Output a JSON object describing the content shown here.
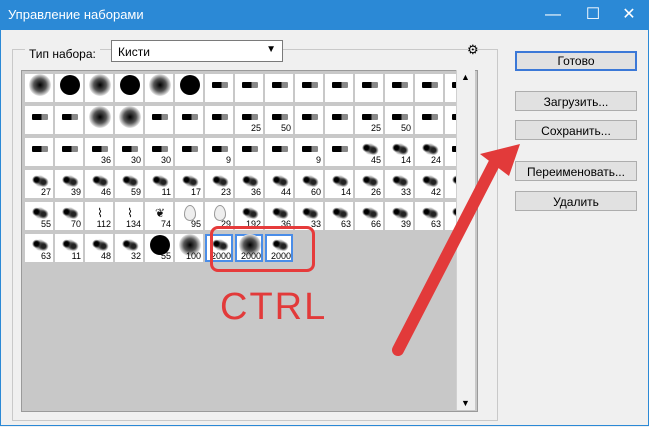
{
  "window": {
    "title": "Управление наборами",
    "min": "—",
    "max": "☐",
    "close": "✕"
  },
  "set_type": {
    "label": "Тип набора:",
    "value": "Кисти"
  },
  "buttons": {
    "done": "Готово",
    "load": "Загрузить...",
    "save": "Сохранить...",
    "rename": "Переименовать...",
    "delete": "Удалить"
  },
  "brushes": [
    {
      "n": "",
      "g": "soft"
    },
    {
      "n": "",
      "g": "hard"
    },
    {
      "n": "",
      "g": "soft"
    },
    {
      "n": "",
      "g": "hard"
    },
    {
      "n": "",
      "g": "soft"
    },
    {
      "n": "",
      "g": "hard"
    },
    {
      "n": "",
      "g": "tool"
    },
    {
      "n": "",
      "g": "tool"
    },
    {
      "n": "",
      "g": "tool"
    },
    {
      "n": "",
      "g": "tool"
    },
    {
      "n": "",
      "g": "tool"
    },
    {
      "n": "",
      "g": "tool"
    },
    {
      "n": "",
      "g": "tool"
    },
    {
      "n": "",
      "g": "tool"
    },
    {
      "n": "",
      "g": "tool"
    },
    {
      "n": "",
      "g": "tool"
    },
    {
      "n": "",
      "g": "tool"
    },
    {
      "n": "",
      "g": "soft"
    },
    {
      "n": "",
      "g": "soft"
    },
    {
      "n": "",
      "g": "tool"
    },
    {
      "n": "",
      "g": "tool"
    },
    {
      "n": "",
      "g": "tool"
    },
    {
      "n": "25",
      "g": "tool"
    },
    {
      "n": "50",
      "g": "tool"
    },
    {
      "n": "",
      "g": "tool"
    },
    {
      "n": "",
      "g": "tool"
    },
    {
      "n": "25",
      "g": "tool"
    },
    {
      "n": "50",
      "g": "tool"
    },
    {
      "n": "",
      "g": "tool"
    },
    {
      "n": "",
      "g": "tool"
    },
    {
      "n": "",
      "g": "tool"
    },
    {
      "n": "",
      "g": "tool"
    },
    {
      "n": "36",
      "g": "tool"
    },
    {
      "n": "30",
      "g": "tool"
    },
    {
      "n": "30",
      "g": "tool"
    },
    {
      "n": "",
      "g": "tool"
    },
    {
      "n": "9",
      "g": "tool"
    },
    {
      "n": "",
      "g": "tool"
    },
    {
      "n": "",
      "g": "tool"
    },
    {
      "n": "9",
      "g": "tool"
    },
    {
      "n": "",
      "g": "tool"
    },
    {
      "n": "45",
      "g": "splat"
    },
    {
      "n": "14",
      "g": "splat"
    },
    {
      "n": "24",
      "g": "splat"
    },
    {
      "n": "",
      "g": "tool"
    },
    {
      "n": "27",
      "g": "splat"
    },
    {
      "n": "39",
      "g": "splat"
    },
    {
      "n": "46",
      "g": "splat"
    },
    {
      "n": "59",
      "g": "splat"
    },
    {
      "n": "11",
      "g": "splat"
    },
    {
      "n": "17",
      "g": "splat"
    },
    {
      "n": "23",
      "g": "splat"
    },
    {
      "n": "36",
      "g": "splat"
    },
    {
      "n": "44",
      "g": "splat"
    },
    {
      "n": "60",
      "g": "splat"
    },
    {
      "n": "14",
      "g": "splat"
    },
    {
      "n": "26",
      "g": "splat"
    },
    {
      "n": "33",
      "g": "splat"
    },
    {
      "n": "42",
      "g": "splat"
    },
    {
      "n": "",
      "g": "splat"
    },
    {
      "n": "55",
      "g": "splat"
    },
    {
      "n": "70",
      "g": "splat"
    },
    {
      "n": "112",
      "g": "grass"
    },
    {
      "n": "134",
      "g": "grass"
    },
    {
      "n": "74",
      "g": "leaf"
    },
    {
      "n": "95",
      "g": "drop"
    },
    {
      "n": "29",
      "g": "drop"
    },
    {
      "n": "192",
      "g": "splat"
    },
    {
      "n": "36",
      "g": "splat"
    },
    {
      "n": "33",
      "g": "splat"
    },
    {
      "n": "63",
      "g": "splat"
    },
    {
      "n": "66",
      "g": "splat"
    },
    {
      "n": "39",
      "g": "splat"
    },
    {
      "n": "63",
      "g": "splat"
    },
    {
      "n": "",
      "g": "splat"
    },
    {
      "n": "63",
      "g": "splat"
    },
    {
      "n": "11",
      "g": "splat"
    },
    {
      "n": "48",
      "g": "splat"
    },
    {
      "n": "32",
      "g": "splat"
    },
    {
      "n": "55",
      "g": "hard"
    },
    {
      "n": "100",
      "g": "soft"
    },
    {
      "n": "2000",
      "g": "splat"
    },
    {
      "n": "2000",
      "g": "soft"
    },
    {
      "n": "2000",
      "g": "splat"
    }
  ],
  "overlay": {
    "label": "CTRL"
  },
  "scrollbar": {
    "up": "▲",
    "down": "▼"
  },
  "colors": {
    "titlebar": "#2b89d6",
    "highlight": "#e63b3b",
    "arrow": "#e23a3a"
  }
}
